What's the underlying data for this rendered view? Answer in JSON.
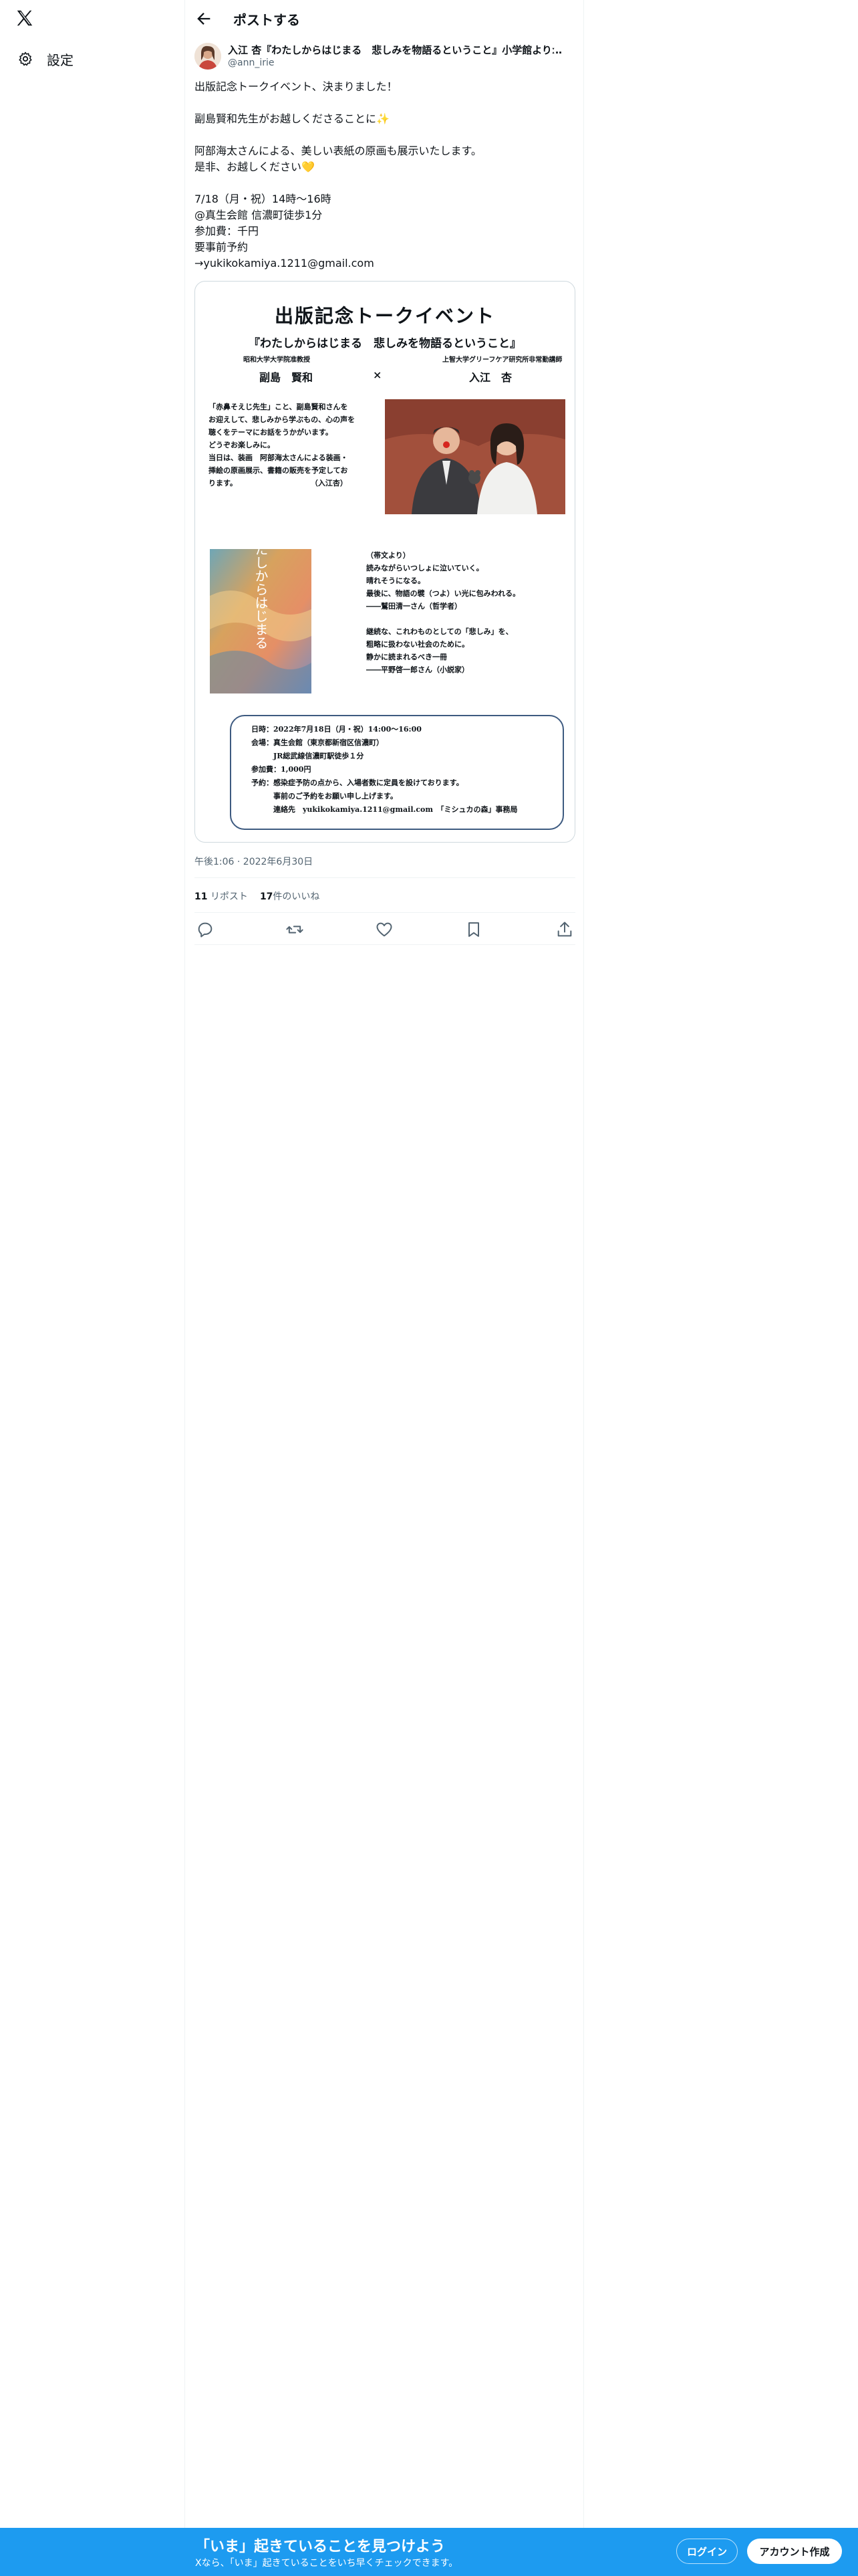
{
  "sidebar": {
    "settings_label": "設定"
  },
  "header": {
    "title": "ポストする"
  },
  "tweet": {
    "author_name": "入江 杏『わたしからはじまる　悲しみを物語るということ』小学館よりː…",
    "author_handle": "@ann_irie",
    "text": "出版記念トークイベント、決まりました！\n\n副島賢和先生がお越しくださることに✨\n\n阿部海太さんによる、美しい表紙の原画も展示いたします。\n是非、お越しください💛\n\n7/18（月・祝）14時〜16時\n@真生会館 信濃町徒歩1分\n参加費：千円\n要事前予約\n→yukikokamiya.1211@gmail.com",
    "timestamp": "午後1:06 · 2022年6月30日",
    "reposts_count": "11",
    "reposts_label": "リポスト",
    "likes_count": "17",
    "likes_label": "件のいいね"
  },
  "flyer": {
    "title": "出版記念トークイベント",
    "subtitle": "『わたしからはじまる　悲しみを物語るということ』",
    "speaker1_affiliation": "昭和大学大学院准教授",
    "speaker1_name": "副島　賢和",
    "cross": "×",
    "speaker2_affiliation": "上智大学グリーフケア研究所非常勤講師",
    "speaker2_name": "入江　杏",
    "quote": "「赤鼻そえじ先生」こと、副島賢和さんを\nお迎えして、悲しみから学ぶもの、心の声を\n聴くをテーマにお話をうかがいます。\nどうぞお楽しみに。\n当日は、装画　阿部海太さんによる装画・\n挿絵の原画展示、書籍の販売を予定してお\nります。　　　　　　　　　　　（入江杏）",
    "blurb": "（帯文より）\n読みながらいつしょに泣いていく。\n晴れそうになる。\n最後に、物語の襞（つよ）い光に包みわれる。\n――鷲田清一さん（哲学者）\n\n継続な、これわものとしての「悲しみ」を、\n粗略に扱わない社会のために。\n静かに読まれるべき一冊\n――平野啓一郎さん（小説家）",
    "info": "日時：2022年7月18日（月・祝）14:00〜16:00\n会場：真生会館（東京都新宿区信濃町）\n　　　JR総武線信濃町駅徒歩１分\n参加費：1,000円\n予約：感染症予防の点から、入場者数に定員を設けております。\n　　　事前のご予約をお願い申し上げます。\n　　　連絡先　yukikokamiya.1211@gmail.com　「ミシュカの森」事務局",
    "book_title": "わたしからはじまる"
  },
  "bottom_bar": {
    "title": "「いま」起きていることを見つけよう",
    "subtitle": "Xなら、「いま」起きていることをいち早くチェックできます。",
    "login_label": "ログイン",
    "signup_label": "アカウント作成"
  },
  "colors": {
    "accent": "#1d9bf0",
    "text": "#0f1419",
    "muted": "#536471",
    "border": "#eff3f4"
  },
  "icons": [
    "x-logo-icon",
    "gear-icon",
    "back-arrow-icon",
    "reply-icon",
    "repost-icon",
    "like-icon",
    "bookmark-icon",
    "share-icon"
  ]
}
